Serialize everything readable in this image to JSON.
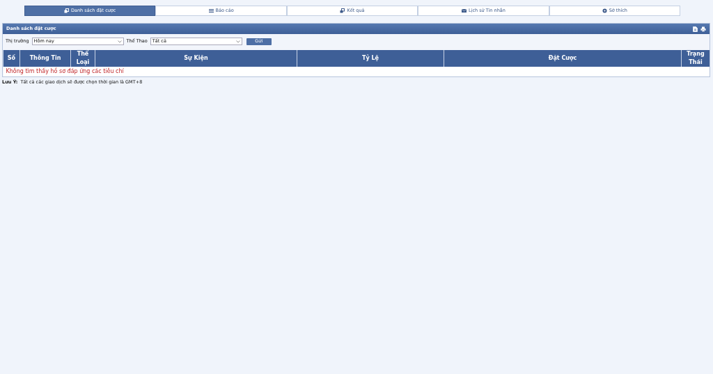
{
  "tabs": [
    {
      "label": "Danh sách đặt cược",
      "selected": true
    },
    {
      "label": "Báo cáo",
      "selected": false
    },
    {
      "label": "Kết quả",
      "selected": false
    },
    {
      "label": "Lịch sử Tin nhắn",
      "selected": false
    },
    {
      "label": "Sở thích",
      "selected": false
    }
  ],
  "panel": {
    "title": "Danh sách đặt cược",
    "filters": [
      {
        "label": "Thị trường",
        "value": "Hôm nay"
      },
      {
        "label": "Thể Thao",
        "value": "Tất cả"
      }
    ],
    "submit": "Gửi",
    "table": {
      "columns": [
        "Số",
        "Thông Tin",
        "Thể Loại",
        "Sự Kiện",
        "Tỷ Lệ",
        "Đặt Cược",
        "Trạng Thái"
      ],
      "empty_message": "Không tìm thấy hồ sơ đáp ứng các tiêu chí"
    }
  },
  "note": {
    "label": "Lưu Ý:",
    "text": "Tất cả các giao dịch sẽ được chọn thời gian là GMT+8"
  }
}
